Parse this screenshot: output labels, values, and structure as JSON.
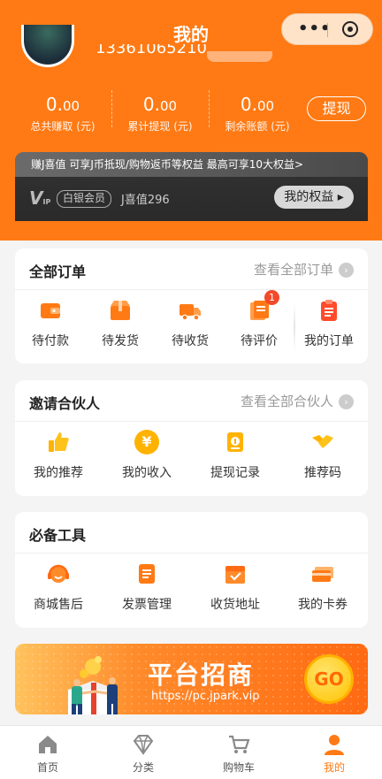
{
  "header": {
    "title": "我的",
    "phone": "13361065210",
    "stats": [
      {
        "int": "0.",
        "dec": "00",
        "label": "总共赚取 (元)"
      },
      {
        "int": "0.",
        "dec": "00",
        "label": "累计提现 (元)"
      },
      {
        "int": "0.",
        "dec": "00",
        "label": "剩余账额 (元)"
      }
    ],
    "withdraw_label": "提现"
  },
  "vip": {
    "promo": "赚J喜值 可享J币抵现/购物返币等权益 最高可享10大权益>",
    "logo": "V",
    "logo_sub": "IP",
    "level": "白银会员",
    "jvalue": "J喜值296",
    "rights_label": "我的权益 ▸"
  },
  "orders": {
    "title": "全部订单",
    "more": "查看全部订单",
    "items": [
      {
        "label": "待付款",
        "icon": "wallet-icon"
      },
      {
        "label": "待发货",
        "icon": "package-icon"
      },
      {
        "label": "待收货",
        "icon": "truck-icon"
      },
      {
        "label": "待评价",
        "icon": "review-icon",
        "badge": "1"
      },
      {
        "label": "我的订单",
        "icon": "clipboard-icon"
      }
    ]
  },
  "partners": {
    "title": "邀请合伙人",
    "more": "查看全部合伙人",
    "items": [
      {
        "label": "我的推荐",
        "icon": "thumbs-up-icon"
      },
      {
        "label": "我的收入",
        "icon": "yen-coin-icon",
        "glyph": "¥"
      },
      {
        "label": "提现记录",
        "icon": "withdraw-record-icon"
      },
      {
        "label": "推荐码",
        "icon": "handshake-icon"
      }
    ]
  },
  "tools": {
    "title": "必备工具",
    "items": [
      {
        "label": "商城售后",
        "icon": "headset-icon"
      },
      {
        "label": "发票管理",
        "icon": "invoice-icon"
      },
      {
        "label": "收货地址",
        "icon": "address-box-icon"
      },
      {
        "label": "我的卡券",
        "icon": "card-coupon-icon"
      }
    ]
  },
  "banner": {
    "title": "平台招商",
    "url": "https://pc.jpark.vip",
    "go": "GO"
  },
  "tabbar": [
    {
      "label": "首页",
      "icon": "home-icon"
    },
    {
      "label": "分类",
      "icon": "diamond-icon"
    },
    {
      "label": "购物车",
      "icon": "cart-icon"
    },
    {
      "label": "我的",
      "icon": "user-icon",
      "active": true
    }
  ],
  "colors": {
    "brand": "#ff7a14",
    "badge": "#f24b2a"
  }
}
